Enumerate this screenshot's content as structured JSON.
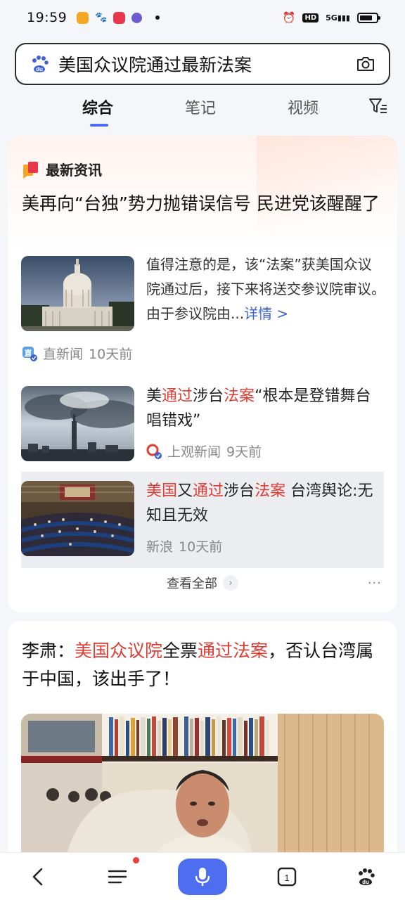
{
  "status_bar": {
    "time": "19:59",
    "apps": [
      "喵喵",
      "百度",
      "小红书",
      "app"
    ],
    "network": "5G",
    "hd": "HD"
  },
  "search": {
    "query": "美国众议院通过最新法案"
  },
  "tabs": [
    {
      "label": "综合",
      "active": true
    },
    {
      "label": "笔记",
      "active": false
    },
    {
      "label": "视频",
      "active": false
    }
  ],
  "news_card": {
    "section_label": "最新资讯",
    "headline": "美再向“台独”势力抛错误信号 民进党该醒醒了",
    "summary": "值得注意的是，该“法案”获美国众议院通过后，接下来将送交参议院审议。由于参议院由...",
    "detail_link": "详情 >",
    "main_source": "直新闻",
    "main_time": "10天前",
    "items": [
      {
        "title_parts": [
          "美",
          "通过",
          "涉台",
          "法案",
          "“根本是登错舞台唱错戏”"
        ],
        "source": "上观新闻",
        "time": "9天前"
      },
      {
        "title_parts": [
          "美国",
          "又",
          "通过",
          "涉台",
          "法案",
          " 台湾舆论:无知且无效"
        ],
        "source": "新浪",
        "time": "10天前"
      }
    ],
    "see_all": "查看全部",
    "more": "···"
  },
  "article_card": {
    "title_parts": [
      "李肃：",
      "美国众议院",
      "全票",
      "通过法案",
      "，否认台湾属于中国，该出手了！"
    ]
  },
  "bottom_nav": {
    "tab_count": "1"
  },
  "colors": {
    "accent": "#4e6ef2",
    "highlight": "#e03c31",
    "link": "#3f63d6"
  }
}
